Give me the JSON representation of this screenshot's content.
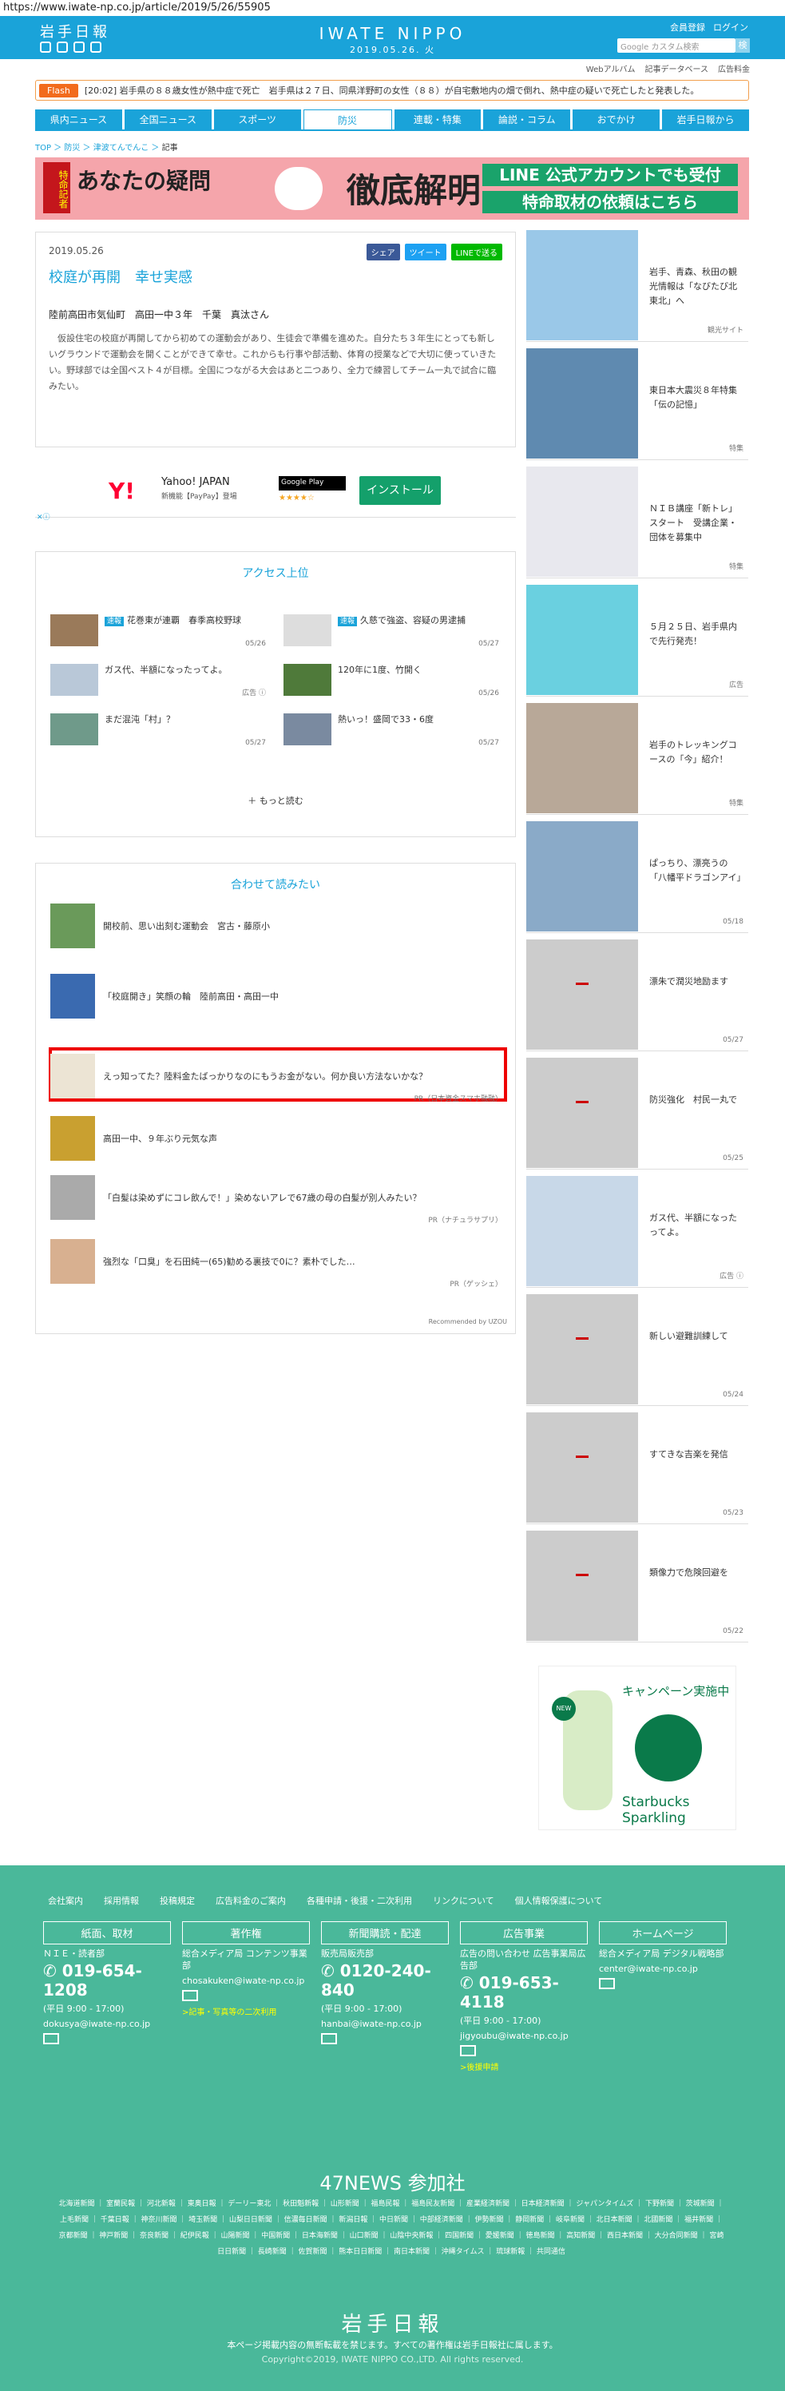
{
  "url": "https://www.iwate-np.co.jp/article/2019/5/26/55905",
  "header": {
    "logo_left": "岩手日報",
    "logo_center": "IWATE NIPPO",
    "date": "2019.05.26. 火",
    "member": "会員登録",
    "login": "ログイン",
    "search_placeholder": "Google カスタム検索",
    "search_btn": "検"
  },
  "sublinks": [
    "Webアルバム",
    "記事データベース",
    "広告料金"
  ],
  "flash": {
    "tag": "Flash",
    "text": "[20:02] 岩手県の８８歳女性が熱中症で死亡　岩手県は２７日、同県洋野町の女性（８８）が自宅敷地内の畑で倒れ、熱中症の疑いで死亡したと発表した。"
  },
  "nav": [
    "県内ニュース",
    "全国ニュース",
    "スポーツ",
    "防災",
    "連載・特集",
    "論説・コラム",
    "おでかけ",
    "岩手日報から"
  ],
  "breadcrumb": {
    "a": "TOP",
    "b": "防災",
    "c": "津波てんでんこ",
    "d": "記事"
  },
  "banner": {
    "tag": "特命記者",
    "q": "あなたの疑問",
    "main": "徹底解明",
    "l1": "LINE 公式アカウントでも受付",
    "l2": "特命取材の依頼はこちら"
  },
  "article": {
    "date": "2019.05.26",
    "title": "校庭が再開　幸せ実感",
    "share_fb": "シェア",
    "share_tw": "ツイート",
    "share_line": "LINEで送る",
    "byline": "陸前高田市気仙町　高田一中３年　千葉　真汰さん",
    "body": "仮設住宅の校庭が再開してから初めての運動会があり、生徒会で準備を進めた。自分たち３年生にとっても新しいグラウンドで運動会を開くことができて幸せ。これからも行事や部活動、体育の授業などで大切に使っていきたい。野球部では全国ベスト４が目標。全国につながる大会はあと二つあり、全力で練習してチーム一丸で試合に臨みたい。"
  },
  "ad": {
    "yahoo": "Y!",
    "title": "Yahoo! JAPAN",
    "sub": "新機能【PayPay】登場",
    "gp": "Google Play",
    "stars": "★★★★☆",
    "install": "インストール",
    "ad_mark": "✕ⓘ"
  },
  "access": {
    "title": "アクセス上位",
    "items": [
      {
        "tag": "速報",
        "text": "花巻東が連覇　春季高校野球",
        "date": "05/26"
      },
      {
        "tag": "速報",
        "text": "久慈で強盗、容疑の男逮捕",
        "date": "05/27"
      },
      {
        "tag": "",
        "text": "ガス代、半額になったってよ。",
        "date": "広告 ⓘ"
      },
      {
        "tag": "",
        "text": "120年に1度、竹開く",
        "date": "05/26"
      },
      {
        "tag": "",
        "text": "まだ混沌「村」？",
        "date": "05/27"
      },
      {
        "tag": "",
        "text": "熱いっ！盛岡で33・6度",
        "date": "05/27"
      }
    ],
    "more": "もっと読む"
  },
  "related": {
    "title": "合わせて読みたい",
    "items": [
      {
        "text": "開校前、思い出刻む運動会　宮古・藤原小",
        "pr": ""
      },
      {
        "text": "「校庭開き」笑顔の輪　陸前高田・高田一中",
        "pr": ""
      },
      {
        "text": "えっ知ってた？陸料金たばっかりなのにもうお金がない。何か良い方法ないかな？",
        "pr": "PR（日本資金スマホ融融）"
      },
      {
        "text": "高田一中、９年ぶり元気な声",
        "pr": ""
      },
      {
        "text": "「白髪は染めずにコレ飲んで！」染めないアレで67歳の母の白髪が別人みたい？",
        "pr": "PR（ナチュラサプリ）"
      },
      {
        "text": "強烈な「口臭」を石田純一(65)勧める裏技で0に？素朴でした…",
        "pr": "PR（ゲッシェ）"
      }
    ],
    "rec": "Recommended by UZOU"
  },
  "side": [
    {
      "text": "岩手、青森、秋田の観光情報は「なびたび北東北」へ",
      "date": "観光サイト"
    },
    {
      "text": "東日本大震災８年特集「伝の記憶」",
      "date": "特集"
    },
    {
      "text": "ＮＩＢ講座「新トレ」スタート　受講企業・団体を募集中",
      "date": "特集"
    },
    {
      "text": "５月２５日、岩手県内で先行発売！",
      "date": "広告"
    },
    {
      "text": "岩手のトレッキングコースの「今」紹介！",
      "date": "特集"
    },
    {
      "text": "ぱっちり、漂亮うの「八幡平ドラゴンアイ」",
      "date": "05/18"
    },
    {
      "text": "漂朱で潤災地励ます",
      "date": "05/27"
    },
    {
      "text": "防災強化　村民一丸で",
      "date": "05/25"
    },
    {
      "text": "ガス代、半額になったってよ。",
      "date": "広告 ⓘ"
    },
    {
      "text": "新しい避難訓練して",
      "date": "05/24"
    },
    {
      "text": "すてきな吉楽を発信",
      "date": "05/23"
    },
    {
      "text": "類像力で危険回避を",
      "date": "05/22"
    }
  ],
  "sidead": {
    "title": "キャンペーン実施中",
    "sparkling": "Starbucks Sparkling",
    "new": "NEW"
  },
  "footer": {
    "links": [
      "会社案内",
      "採用情報",
      "投稿規定",
      "広告料金のご案内",
      "各種申請・後援・二次利用",
      "リンクについて",
      "個人情報保護について"
    ],
    "cols": [
      {
        "head": "紙面、取材",
        "l1": "ＮＩＥ・読者部",
        "tel": "019-654-1208",
        "hours": "(平日 9:00 - 17:00)",
        "mail": "dokusya@iwate-np.co.jp",
        "extra": ""
      },
      {
        "head": "著作権",
        "l1": "総合メディア局 コンテンツ事業部",
        "tel": "",
        "hours": "",
        "mail": "chosakuken@iwate-np.co.jp",
        "extra": ">記事・写真等の二次利用"
      },
      {
        "head": "新聞購読・配達",
        "l1": "販売局販売部",
        "tel": "0120-240-840",
        "hours": "(平日 9:00 - 17:00)",
        "mail": "hanbai@iwate-np.co.jp",
        "extra": ""
      },
      {
        "head": "広告事業",
        "l1": "広告の問い合わせ 広告事業局広告部",
        "tel": "019-653-4118",
        "hours": "(平日 9:00 - 17:00)",
        "mail": "jigyoubu@iwate-np.co.jp",
        "extra": ">後援申請"
      },
      {
        "head": "ホームページ",
        "l1": "総合メディア局 デジタル戦略部",
        "tel": "",
        "hours": "",
        "mail": "center@iwate-np.co.jp",
        "extra": ""
      }
    ],
    "n47": "47NEWS 参加社",
    "papers": "北海道新聞 ｜ 室蘭民報 ｜ 河北新報 ｜ 東奥日報 ｜ デーリー東北 ｜ 秋田魁新報 ｜ 山形新聞 ｜ 福島民報 ｜ 福島民友新聞 ｜ 産業経済新聞 ｜ 日本経済新聞 ｜ ジャパンタイムズ ｜ 下野新聞 ｜ 茨城新聞 ｜ 上毛新聞 ｜ 千葉日報 ｜ 神奈川新聞 ｜ 埼玉新聞 ｜ 山梨日日新聞 ｜ 信濃毎日新聞 ｜ 新潟日報 ｜ 中日新聞 ｜ 中部経済新聞 ｜ 伊勢新聞 ｜ 静岡新聞 ｜ 岐阜新聞 ｜ 北日本新聞 ｜ 北國新聞 ｜ 福井新聞 ｜ 京都新聞 ｜ 神戸新聞 ｜ 奈良新聞 ｜ 紀伊民報 ｜ 山陽新聞 ｜ 中国新聞 ｜ 日本海新聞 ｜ 山口新聞 ｜ 山陰中央新報 ｜ 四国新聞 ｜ 愛媛新聞 ｜ 徳島新聞 ｜ 高知新聞 ｜ 西日本新聞 ｜ 大分合同新聞 ｜ 宮崎日日新聞 ｜ 長崎新聞 ｜ 佐賀新聞 ｜ 熊本日日新聞 ｜ 南日本新聞 ｜ 沖縄タイムス ｜ 琉球新報 ｜ 共同通信",
    "logo": "岩手日報",
    "copy": "本ページ掲載内容の無断転載を禁じます。すべての著作権は岩手日報社に属します。",
    "copy2": "Copyright©2019, IWATE NIPPO CO.,LTD. All rights reserved."
  }
}
